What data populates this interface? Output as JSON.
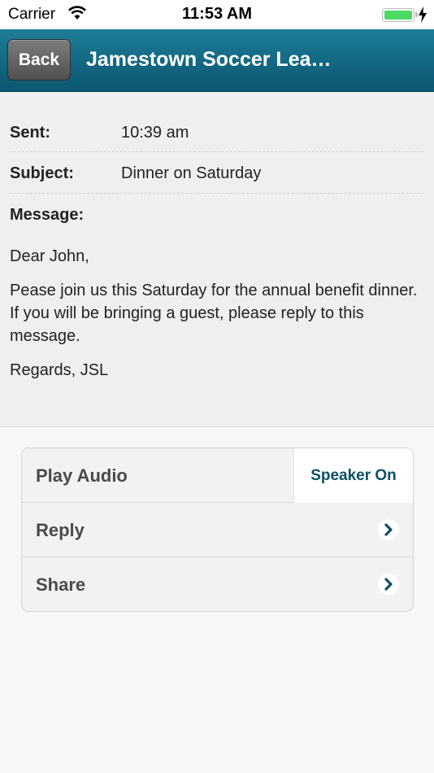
{
  "status_bar": {
    "carrier": "Carrier",
    "time": "11:53 AM",
    "battery_color": "#4cd964"
  },
  "nav": {
    "back_label": "Back",
    "title": "Jamestown Soccer Lea…",
    "bar_color": "#0c5670"
  },
  "message": {
    "sent_label": "Sent:",
    "sent_value": "10:39 am",
    "subject_label": "Subject:",
    "subject_value": "Dinner on Saturday",
    "message_label": "Message:",
    "body": [
      "Dear John,",
      "Pease join us this Saturday for the annual benefit dinner. If you will be bringing a guest, please reply to this message.",
      "Regards, JSL"
    ]
  },
  "actions": {
    "play_audio_label": "Play Audio",
    "speaker_label": "Speaker On",
    "reply_label": "Reply",
    "share_label": "Share",
    "accent_color": "#0d4f66"
  },
  "icons": [
    "wifi-icon",
    "battery-icon",
    "charging-bolt-icon",
    "chevron-right-icon"
  ]
}
